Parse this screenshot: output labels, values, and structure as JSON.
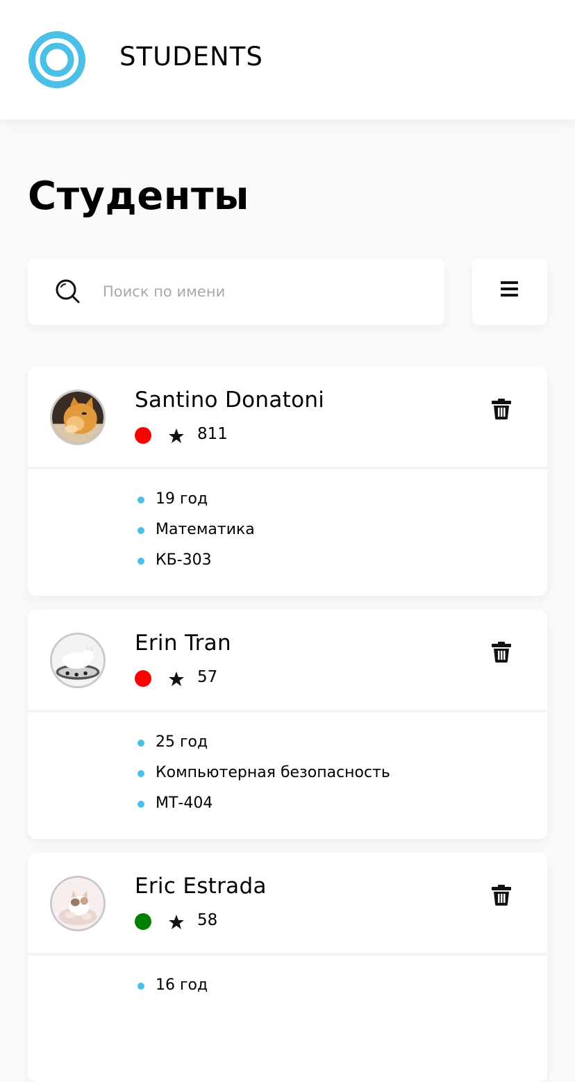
{
  "header": {
    "app_title": "STUDENTS",
    "logo_icon": "ring-logo-icon",
    "accent_color": "#4bbfe6"
  },
  "page": {
    "title": "Студенты"
  },
  "search": {
    "placeholder": "Поиск по имени",
    "value": "",
    "icon": "search-icon"
  },
  "toolbar": {
    "menu_icon": "hamburger-menu-icon"
  },
  "students": [
    {
      "name": "Santino Donatoni",
      "status_color": "#ff0000",
      "rating": "811",
      "avatar": "orange-kitten-avatar",
      "details": [
        "19 год",
        "Математика",
        "КБ-303"
      ]
    },
    {
      "name": "Erin Tran",
      "status_color": "#ff0000",
      "rating": "57",
      "avatar": "white-cat-avatar",
      "details": [
        "25 год",
        "Компьютерная безопасность",
        "МТ-404"
      ]
    },
    {
      "name": "Eric Estrada",
      "status_color": "#008000",
      "rating": "58",
      "avatar": "kitten-avatar",
      "details": [
        "16 год"
      ]
    }
  ]
}
